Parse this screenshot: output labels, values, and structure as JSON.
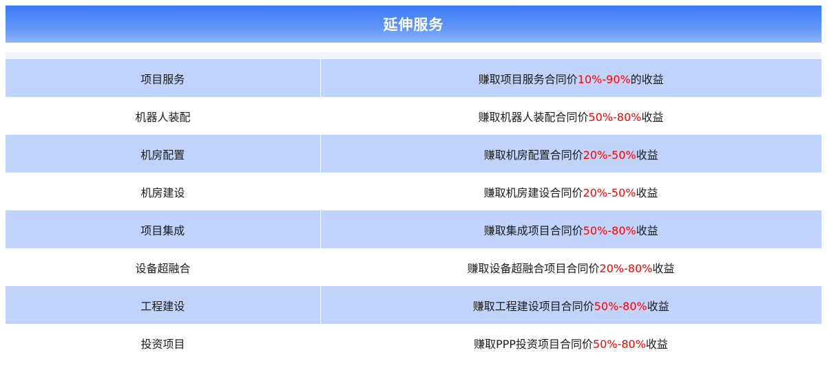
{
  "header": {
    "title": "延伸服务"
  },
  "colors": {
    "header_start": "#3a7af5",
    "header_end": "#8db4fa",
    "row_alt": "#c0d3fb",
    "highlight": "#ff0000"
  },
  "rows": [
    {
      "name": "项目服务",
      "desc_pre": "赚取项目服务合同价",
      "desc_range": "10%-90%",
      "desc_post": "的收益"
    },
    {
      "name": "机器人装配",
      "desc_pre": "赚取机器人装配合同价",
      "desc_range": "50%-80%",
      "desc_post": "收益"
    },
    {
      "name": "机房配置",
      "desc_pre": "赚取机房配置合同价",
      "desc_range": "20%-50%",
      "desc_post": "收益"
    },
    {
      "name": "机房建设",
      "desc_pre": "赚取机房建设合同价",
      "desc_range": "20%-50%",
      "desc_post": "收益"
    },
    {
      "name": "项目集成",
      "desc_pre": "赚取集成项目合同价",
      "desc_range": "50%-80%",
      "desc_post": "收益"
    },
    {
      "name": "设备超融合",
      "desc_pre": "赚取设备超融合项目合同价",
      "desc_range": "20%-80%",
      "desc_post": "收益"
    },
    {
      "name": "工程建设",
      "desc_pre": "赚取工程建设项目合同价",
      "desc_range": "50%-80%",
      "desc_post": "收益"
    },
    {
      "name": "投资项目",
      "desc_pre": "赚取PPP投资项目合同价",
      "desc_range": "50%-80%",
      "desc_post": "收益"
    }
  ]
}
